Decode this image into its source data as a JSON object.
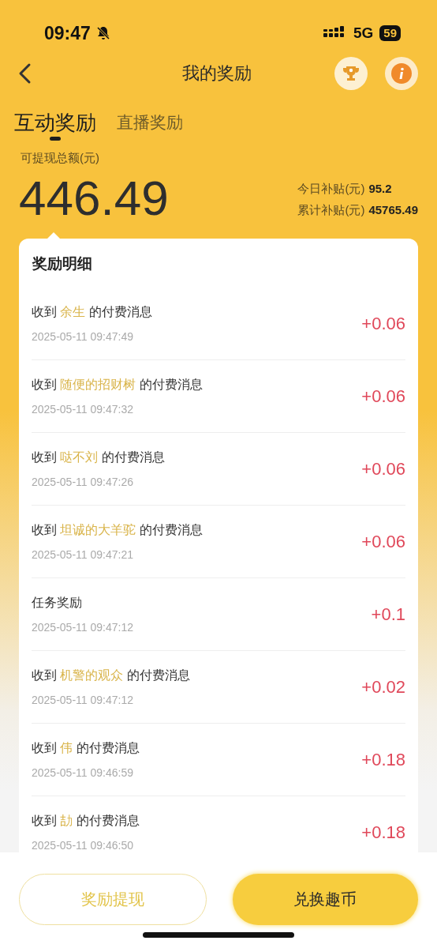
{
  "status_bar": {
    "time": "09:47",
    "network": "5G",
    "battery": "59"
  },
  "header": {
    "title": "我的奖励"
  },
  "tabs": [
    {
      "label": "互动奖励",
      "selected": true
    },
    {
      "label": "直播奖励",
      "selected": false
    }
  ],
  "summary": {
    "label": "可提现总额(元)",
    "amount": "446.49",
    "stats": [
      {
        "label": "今日补贴(元)",
        "value": "95.2"
      },
      {
        "label": "累计补贴(元)",
        "value": "45765.49"
      }
    ]
  },
  "details": {
    "title": "奖励明细",
    "items": [
      {
        "kind": "message",
        "prefix": "收到",
        "name": "余生",
        "suffix": "的付费消息",
        "time": "2025-05-11 09:47:49",
        "amount": "+0.06"
      },
      {
        "kind": "message",
        "prefix": "收到",
        "name": "随便的招财树",
        "suffix": "的付费消息",
        "time": "2025-05-11 09:47:32",
        "amount": "+0.06"
      },
      {
        "kind": "message",
        "prefix": "收到",
        "name": "哒不刘",
        "suffix": "的付费消息",
        "time": "2025-05-11 09:47:26",
        "amount": "+0.06"
      },
      {
        "kind": "message",
        "prefix": "收到",
        "name": "坦诚的大羊驼",
        "suffix": "的付费消息",
        "time": "2025-05-11 09:47:21",
        "amount": "+0.06"
      },
      {
        "kind": "task",
        "text": "任务奖励",
        "time": "2025-05-11 09:47:12",
        "amount": "+0.1"
      },
      {
        "kind": "message",
        "prefix": "收到",
        "name": "机警的观众",
        "suffix": "的付费消息",
        "time": "2025-05-11 09:47:12",
        "amount": "+0.02"
      },
      {
        "kind": "message",
        "prefix": "收到",
        "name": "伟",
        "suffix": "的付费消息",
        "time": "2025-05-11 09:46:59",
        "amount": "+0.18"
      },
      {
        "kind": "message",
        "prefix": "收到",
        "name": "劼",
        "suffix": "的付费消息",
        "time": "2025-05-11 09:46:50",
        "amount": "+0.18"
      }
    ]
  },
  "buttons": [
    {
      "label": "奖励提现",
      "kind": "outline"
    },
    {
      "label": "兑换趣币",
      "kind": "filled"
    }
  ]
}
